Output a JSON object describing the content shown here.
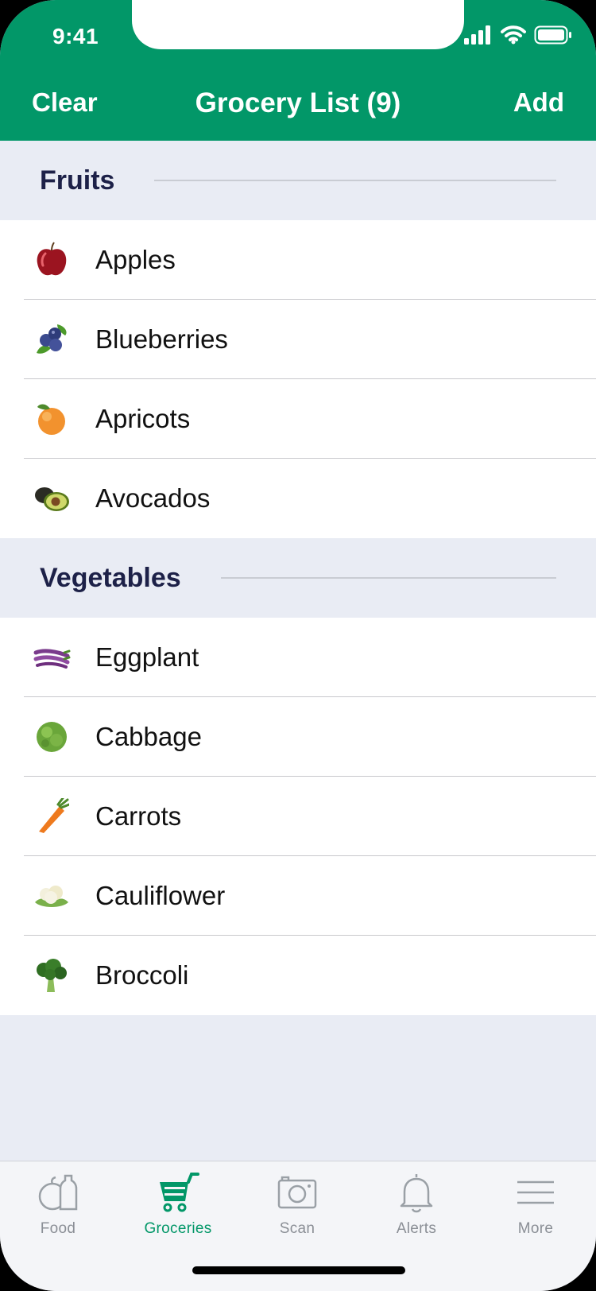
{
  "status_bar": {
    "time": "9:41"
  },
  "nav": {
    "clear_label": "Clear",
    "title": "Grocery List (9)",
    "add_label": "Add"
  },
  "sections": [
    {
      "title": "Fruits",
      "items": [
        {
          "label": "Apples",
          "icon": "apple-icon"
        },
        {
          "label": "Blueberries",
          "icon": "blueberries-icon"
        },
        {
          "label": "Apricots",
          "icon": "apricot-icon"
        },
        {
          "label": "Avocados",
          "icon": "avocado-icon"
        }
      ]
    },
    {
      "title": "Vegetables",
      "items": [
        {
          "label": "Eggplant",
          "icon": "eggplant-icon"
        },
        {
          "label": "Cabbage",
          "icon": "cabbage-icon"
        },
        {
          "label": "Carrots",
          "icon": "carrot-icon"
        },
        {
          "label": "Cauliflower",
          "icon": "cauliflower-icon"
        },
        {
          "label": "Broccoli",
          "icon": "broccoli-icon"
        }
      ]
    }
  ],
  "tabbar": {
    "tabs": [
      {
        "label": "Food",
        "icon": "food-icon",
        "active": false
      },
      {
        "label": "Groceries",
        "icon": "cart-icon",
        "active": true
      },
      {
        "label": "Scan",
        "icon": "camera-icon",
        "active": false
      },
      {
        "label": "Alerts",
        "icon": "bell-icon",
        "active": false
      },
      {
        "label": "More",
        "icon": "menu-icon",
        "active": false
      }
    ]
  },
  "colors": {
    "brand_green": "#029768",
    "section_bg": "#e9ecf4",
    "section_title": "#1d2148",
    "tab_inactive": "#8b8f96"
  }
}
